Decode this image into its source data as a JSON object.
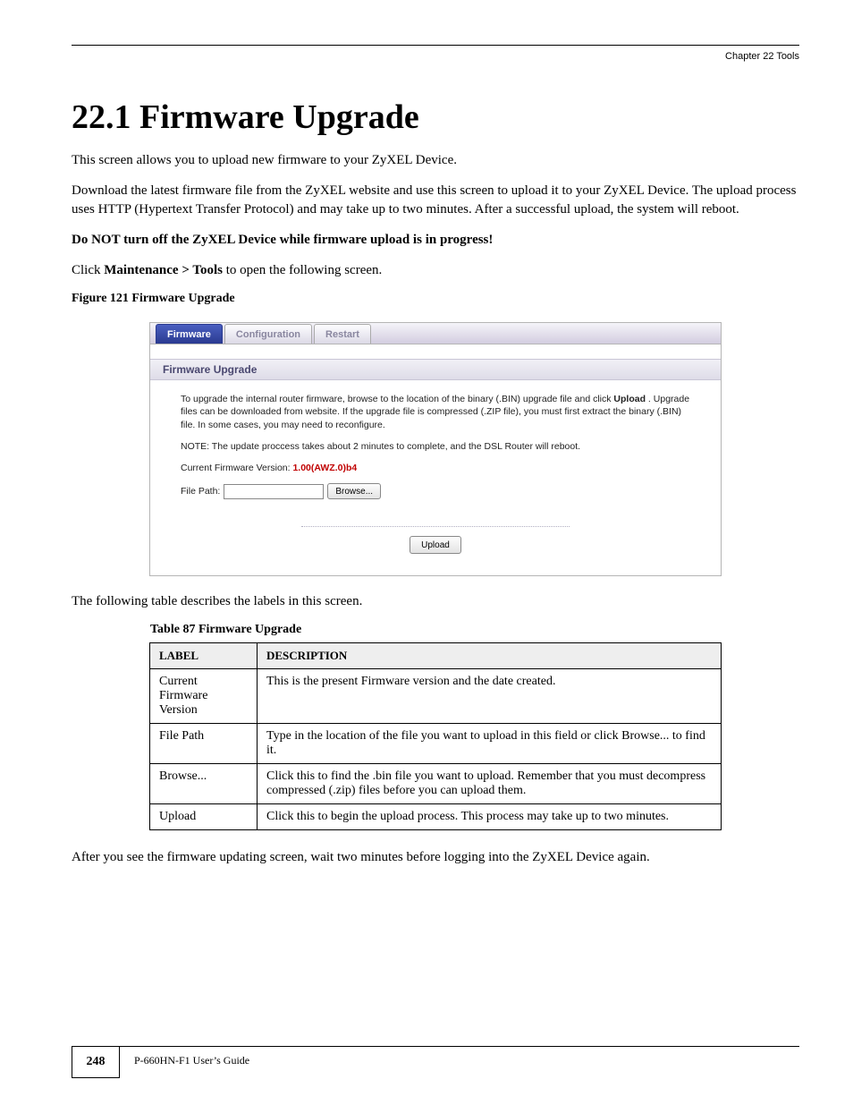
{
  "header": {
    "running": "Chapter 22 Tools"
  },
  "chapter": {
    "title": "22.1  Firmware Upgrade",
    "intro_line1": "This screen allows you to upload new firmware to your ZyXEL Device.",
    "intro_line2_plain": "Download the latest firmware file from the ZyXEL website and use this screen to upload it to your ZyXEL Device. The upload process uses HTTP (Hypertext Transfer Protocol) and may take up to two minutes. After a successful upload, the system will reboot.",
    "warning": "Do NOT turn off the ZyXEL Device while firmware upload is in progress!",
    "click_line_prefix": "Click ",
    "click_line_bold": "Maintenance > Tools",
    "click_line_suffix": " to open the following screen."
  },
  "screenshot": {
    "tabs": [
      "Firmware",
      "Configuration",
      "Restart"
    ],
    "section_title": "Firmware Upgrade",
    "para1_a": "To upgrade the internal router firmware, browse to the location of the binary (.BIN) upgrade file and click ",
    "para1_b": "Upload",
    "para1_c": " . Upgrade files can be downloaded from website. If the upgrade file is compressed (.ZIP file), you must first extract the binary (.BIN) file. In some cases, you may need to reconfigure.",
    "note": "NOTE: The update proccess takes about 2 minutes to complete, and the DSL Router will reboot.",
    "fw_label": "Current Firmware Version: ",
    "fw_version": "1.00(AWZ.0)b4",
    "file_path_label": "File Path:",
    "browse": "Browse...",
    "upload": "Upload"
  },
  "figure_caption": "Figure 121   Firmware Upgrade",
  "table_intro": "The following table describes the labels in this screen.",
  "table_caption": "Table 87   Firmware Upgrade",
  "table": {
    "headers": [
      "LABEL",
      "DESCRIPTION"
    ],
    "rows": [
      {
        "label": "Current Firmware Version",
        "desc": "This is the present Firmware version and the date created."
      },
      {
        "label": "File Path",
        "desc": "Type in the location of the file you want to upload in this field or click Browse... to find it."
      },
      {
        "label": "Browse...",
        "desc": "Click this to find the .bin file you want to upload. Remember that you must decompress compressed (.zip) files before you can upload them."
      },
      {
        "label": "Upload",
        "desc": "Click this to begin the upload process. This process may take up to two minutes."
      }
    ]
  },
  "post_text": "After you see the firmware updating screen, wait two minutes before logging into the ZyXEL Device again.",
  "footer": {
    "page": "248",
    "guide": "P-660HN-F1 User’s Guide"
  }
}
